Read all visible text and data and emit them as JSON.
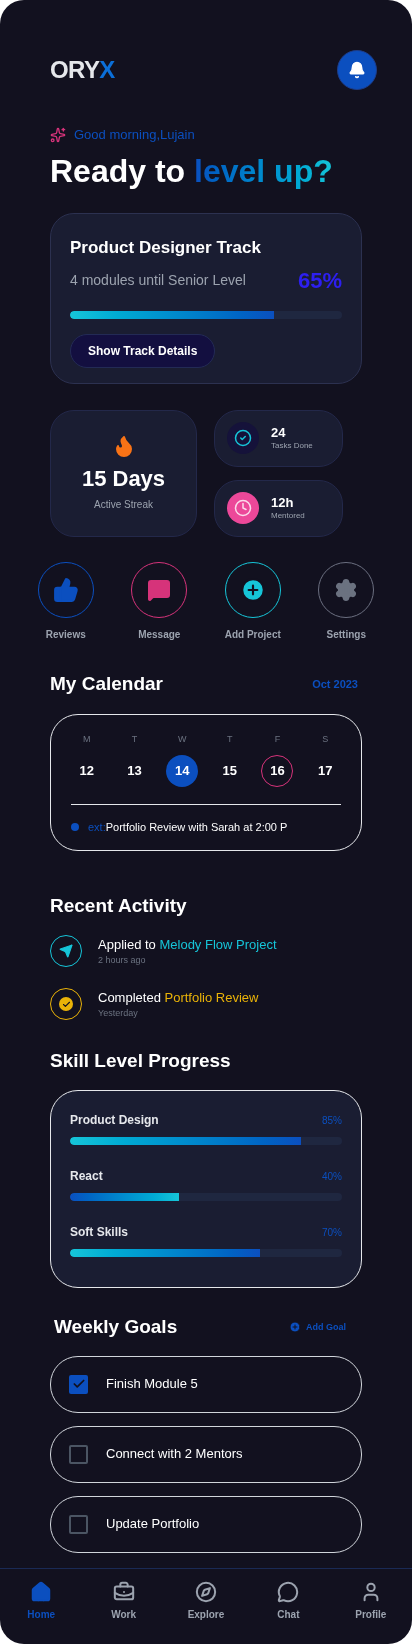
{
  "header": {
    "logo": "ORY",
    "logo_accent": "X"
  },
  "greeting": "Good morning,Lujain",
  "headline": {
    "text": "Ready to",
    "accent": "level up?"
  },
  "track": {
    "title": "Product Designer Track",
    "subtitle": "4 modules until Senior Level",
    "percent": "65%",
    "level": 0.75,
    "button": "Show Track Details"
  },
  "streak": {
    "value": "15 Days",
    "label": "Active Streak"
  },
  "stats": [
    {
      "kind": "tasks",
      "value": "24",
      "label": "Tasks Done"
    },
    {
      "kind": "mentored",
      "value": "12h",
      "label": "Mentored"
    }
  ],
  "actions": [
    {
      "kind": "reviews",
      "label": "Reviews"
    },
    {
      "kind": "message",
      "label": "Message"
    },
    {
      "kind": "add",
      "label": "Add Project"
    },
    {
      "kind": "settings",
      "label": "Settings"
    }
  ],
  "calendar": {
    "title": "My Calendar",
    "month": "Oct 2023",
    "days": [
      {
        "weekday": "M",
        "date": "12",
        "selected": false,
        "marked": false
      },
      {
        "weekday": "T",
        "date": "13",
        "selected": false,
        "marked": false
      },
      {
        "weekday": "W",
        "date": "14",
        "selected": true,
        "marked": false
      },
      {
        "weekday": "T",
        "date": "15",
        "selected": false,
        "marked": false
      },
      {
        "weekday": "F",
        "date": "16",
        "selected": false,
        "marked": true
      },
      {
        "weekday": "S",
        "date": "17",
        "selected": false,
        "marked": false
      }
    ],
    "next_label": "ext:",
    "next_text": "Portfolio Review with Sarah at 2:00 P"
  },
  "activity": {
    "title": "Recent Activity",
    "items": [
      {
        "kind": "applied",
        "text": "Applied to",
        "highlight": "Melody Flow Project",
        "time": "2 hours ago"
      },
      {
        "kind": "completed",
        "text": "Completed",
        "highlight": "Portfolio Review",
        "time": "Yesterday"
      }
    ]
  },
  "skills": {
    "title": "Skill Level Progress",
    "items": [
      {
        "name": "Product Design",
        "percent": "85%",
        "level": 0.85
      },
      {
        "name": "React",
        "percent": "40%",
        "level": 0.4
      },
      {
        "name": "Soft Skills",
        "percent": "70%",
        "level": 0.7
      }
    ]
  },
  "goals": {
    "title": "Weekly Goals",
    "add": "Add Goal",
    "items": [
      {
        "text": "Finish Module 5",
        "checked": true
      },
      {
        "text": "Connect with 2 Mentors",
        "checked": false
      },
      {
        "text": "Update Portfolio",
        "checked": false
      }
    ]
  },
  "nav": [
    {
      "kind": "home",
      "label": "Home",
      "selected": true
    },
    {
      "kind": "work",
      "label": "Work",
      "selected": false
    },
    {
      "kind": "explore",
      "label": "Explore",
      "selected": false
    },
    {
      "kind": "chat",
      "label": "Chat",
      "selected": false
    },
    {
      "kind": "profile",
      "label": "Profile",
      "selected": false
    }
  ]
}
